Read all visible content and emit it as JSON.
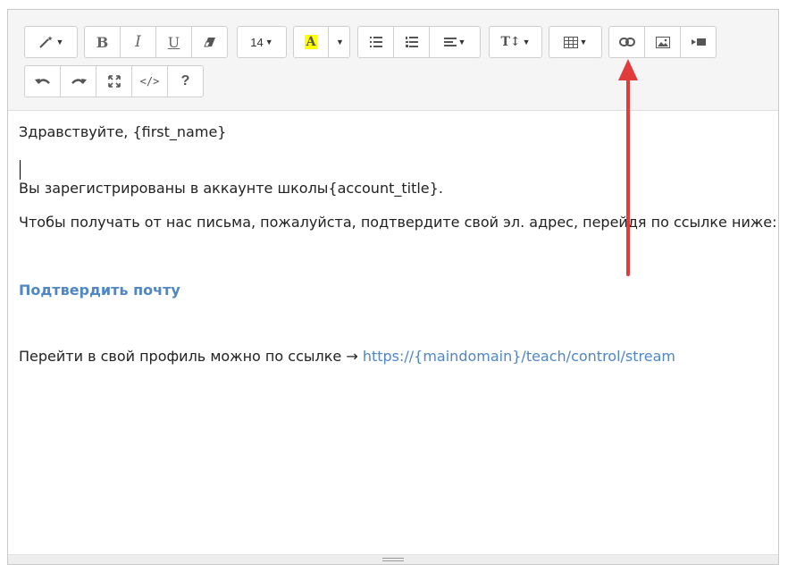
{
  "toolbar": {
    "font_size": "14",
    "highlight_letter": "A",
    "text_size_label": "T↕",
    "code_label": "</>",
    "help_label": "?",
    "highlight_color": "#ffff00"
  },
  "content": {
    "greeting": "Здравствуйте, {first_name}",
    "registered": "Вы зарегистрированы в  аккаунте школы{account_title}.",
    "confirm_prompt": "Чтобы получать от нас письма, пожалуйста, подтвердите свой эл. адрес, перейдя по ссылке ниже:",
    "confirm_link": "Подтвердить почту",
    "profile_text": "Перейти в свой профиль можно по ссылке → ",
    "profile_link": "https://{maindomain}/teach/control/stream"
  },
  "colors": {
    "link": "#4f86c6",
    "annotation_arrow": "#e03c3c"
  },
  "icons": [
    "magic-wand-icon",
    "bold-icon",
    "italic-icon",
    "underline-icon",
    "eraser-icon",
    "font-size-icon",
    "highlight-icon",
    "unordered-list-icon",
    "ordered-list-icon",
    "align-icon",
    "text-height-icon",
    "table-icon",
    "link-icon",
    "image-icon",
    "video-icon",
    "undo-icon",
    "redo-icon",
    "fullscreen-icon",
    "code-view-icon",
    "help-icon"
  ]
}
